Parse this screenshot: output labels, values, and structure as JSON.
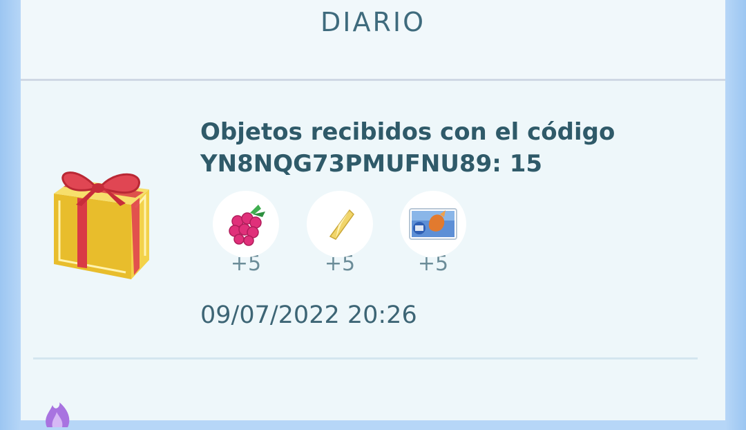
{
  "header": {
    "title": "DIARIO"
  },
  "entry": {
    "title_line1": "Objetos recibidos con el código",
    "title_line2": "YN8NQG73PMUFNU89: 15",
    "items": [
      {
        "icon": "razz-berry-icon",
        "count": "+5"
      },
      {
        "icon": "star-piece-icon",
        "count": "+5"
      },
      {
        "icon": "sticker-icon",
        "count": "+5"
      }
    ],
    "date": "09/07/2022 20:26"
  },
  "colors": {
    "accent_text": "#2f5a69",
    "panel_bg": "#eef7fa",
    "side_bg": "#b6d6f7"
  }
}
